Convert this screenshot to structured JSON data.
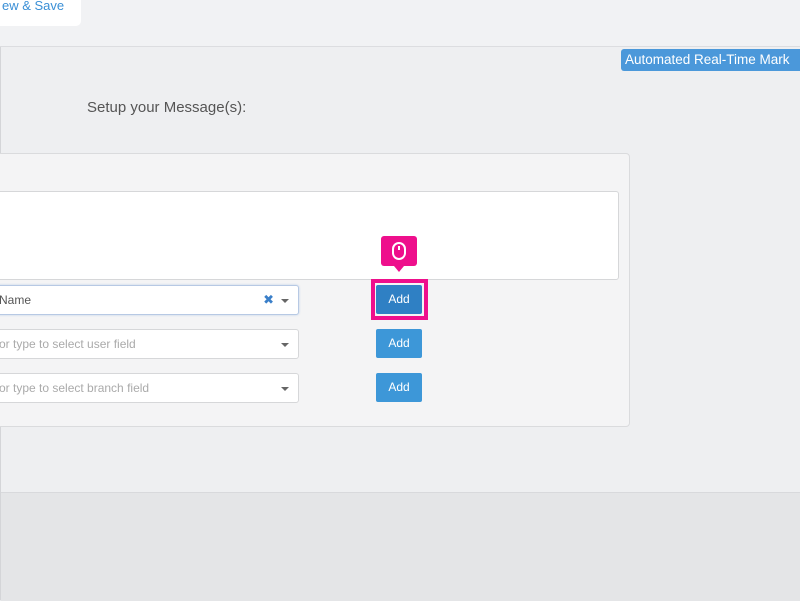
{
  "header": {
    "save_tab_label": "ew & Save"
  },
  "badge": {
    "label": "Automated Real-Time Mark"
  },
  "setup": {
    "heading": "Setup your Message(s):"
  },
  "fields": [
    {
      "value": "Name",
      "placeholder": ""
    },
    {
      "value": "",
      "placeholder": "or type to select user field"
    },
    {
      "value": "",
      "placeholder": "or type to select branch field"
    }
  ],
  "buttons": {
    "add_label": "Add"
  },
  "icons": {
    "cursor_hint": "mouse-icon",
    "clear": "close-icon",
    "dropdown": "chevron-down-icon"
  },
  "colors": {
    "accent": "#3d97d8",
    "highlight": "#ee0f8c"
  }
}
